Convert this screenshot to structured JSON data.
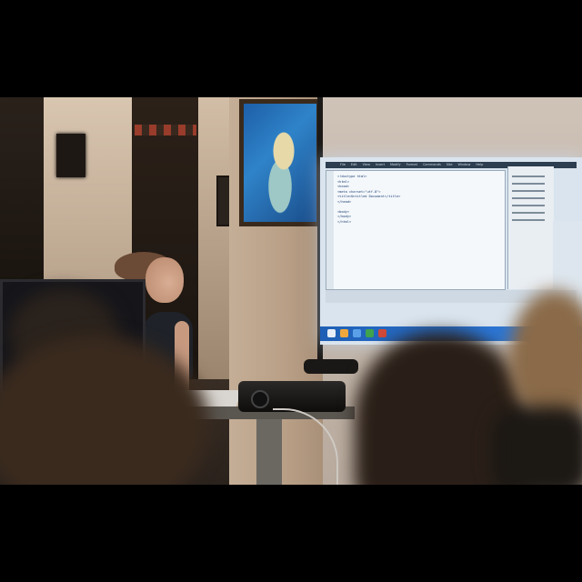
{
  "scene": {
    "subjects": [
      "presenter",
      "projection-screen",
      "projector",
      "painting",
      "computer-monitor",
      "audience"
    ]
  },
  "screen": {
    "menu": [
      "File",
      "Edit",
      "View",
      "Insert",
      "Modify",
      "Format",
      "Commands",
      "Site",
      "Window",
      "Help"
    ],
    "code_lines": [
      "<!doctype html>",
      "<html>",
      "<head>",
      "<meta charset=\"utf-8\">",
      "<title>Untitled Document</title>",
      "</head>",
      "",
      "<body>",
      "</body>",
      "</html>"
    ],
    "doc_title": "Untitled Document"
  },
  "colors": {
    "screen_glow": "#d9e4ee",
    "taskbar": "#2c77d6",
    "painting_blue": "#2f83c9"
  }
}
